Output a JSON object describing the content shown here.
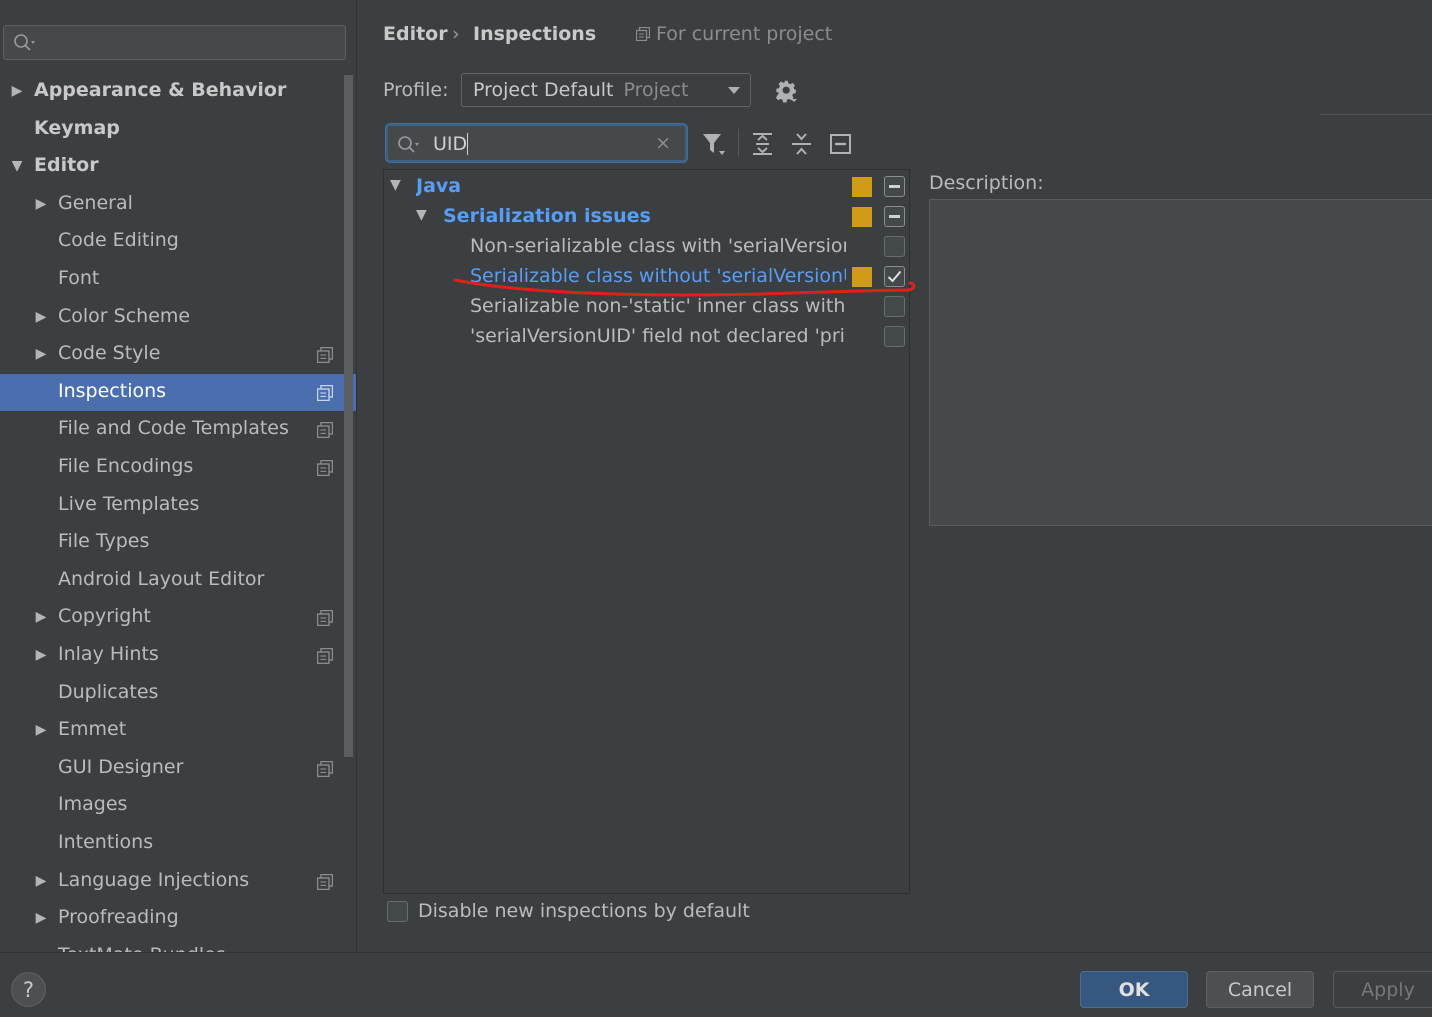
{
  "sidebar": {
    "search": {
      "value": ""
    },
    "items": [
      {
        "label": "Appearance & Behavior",
        "level": 0,
        "arrow": "right",
        "project": false
      },
      {
        "label": "Keymap",
        "level": 0,
        "arrow": "none",
        "project": false
      },
      {
        "label": "Editor",
        "level": 0,
        "arrow": "down",
        "project": false
      },
      {
        "label": "General",
        "level": 1,
        "arrow": "right",
        "project": false
      },
      {
        "label": "Code Editing",
        "level": 1,
        "arrow": "none",
        "project": false
      },
      {
        "label": "Font",
        "level": 1,
        "arrow": "none",
        "project": false
      },
      {
        "label": "Color Scheme",
        "level": 1,
        "arrow": "right",
        "project": false
      },
      {
        "label": "Code Style",
        "level": 1,
        "arrow": "right",
        "project": true
      },
      {
        "label": "Inspections",
        "level": 1,
        "arrow": "none",
        "project": true,
        "selected": true
      },
      {
        "label": "File and Code Templates",
        "level": 1,
        "arrow": "none",
        "project": true
      },
      {
        "label": "File Encodings",
        "level": 1,
        "arrow": "none",
        "project": true
      },
      {
        "label": "Live Templates",
        "level": 1,
        "arrow": "none",
        "project": false
      },
      {
        "label": "File Types",
        "level": 1,
        "arrow": "none",
        "project": false
      },
      {
        "label": "Android Layout Editor",
        "level": 1,
        "arrow": "none",
        "project": false
      },
      {
        "label": "Copyright",
        "level": 1,
        "arrow": "right",
        "project": true
      },
      {
        "label": "Inlay Hints",
        "level": 1,
        "arrow": "right",
        "project": true
      },
      {
        "label": "Duplicates",
        "level": 1,
        "arrow": "none",
        "project": false
      },
      {
        "label": "Emmet",
        "level": 1,
        "arrow": "right",
        "project": false
      },
      {
        "label": "GUI Designer",
        "level": 1,
        "arrow": "none",
        "project": true
      },
      {
        "label": "Images",
        "level": 1,
        "arrow": "none",
        "project": false
      },
      {
        "label": "Intentions",
        "level": 1,
        "arrow": "none",
        "project": false
      },
      {
        "label": "Language Injections",
        "level": 1,
        "arrow": "right",
        "project": true
      },
      {
        "label": "Proofreading",
        "level": 1,
        "arrow": "right",
        "project": false
      },
      {
        "label": "TextMate Bundles",
        "level": 1,
        "arrow": "none",
        "project": false
      }
    ]
  },
  "breadcrumb": {
    "parent": "Editor",
    "separator": "›",
    "current": "Inspections",
    "scope": "For current project"
  },
  "profile": {
    "label": "Profile:",
    "value": "Project Default",
    "scope": "Project"
  },
  "inspection_search": {
    "value": "UID",
    "clear_glyph": "×"
  },
  "inspections": [
    {
      "label": "Java",
      "kind": "category",
      "indent": 0,
      "severity": true,
      "check": "mixed"
    },
    {
      "label": "Serialization issues",
      "kind": "category",
      "indent": 1,
      "severity": true,
      "check": "mixed"
    },
    {
      "label": "Non-serializable class with 'serialVersionUID'",
      "kind": "item",
      "indent": 2,
      "severity": false,
      "check": "off"
    },
    {
      "label": "Serializable class without 'serialVersionUID'",
      "kind": "item",
      "indent": 2,
      "severity": true,
      "check": "on",
      "selected": true
    },
    {
      "label": "Serializable non-'static' inner class without 'serialVersionUID'",
      "kind": "item",
      "indent": 2,
      "severity": false,
      "check": "off"
    },
    {
      "label": "'serialVersionUID' field not declared 'private static final long'",
      "kind": "item",
      "indent": 2,
      "severity": false,
      "check": "off"
    }
  ],
  "description": {
    "label": "Description:",
    "text": ""
  },
  "disable_new": {
    "label": "Disable new inspections by default",
    "checked": false
  },
  "buttons": {
    "help": "?",
    "ok": "OK",
    "cancel": "Cancel",
    "apply": "Apply"
  },
  "colors": {
    "accent": "#4b6eaf",
    "link": "#589df6",
    "severity_warning": "#d09b17",
    "annotation": "#e0201b"
  },
  "icons": [
    "search-icon",
    "project-scope-icon",
    "gear-icon",
    "filter-icon",
    "expand-all-icon",
    "collapse-all-icon",
    "reset-icon",
    "help-icon"
  ]
}
